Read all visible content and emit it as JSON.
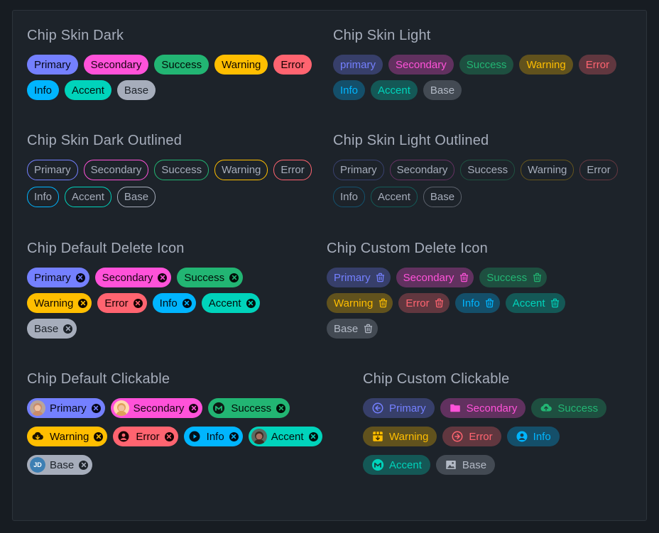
{
  "sections": {
    "dark": {
      "title": "Chip Skin Dark",
      "chips": [
        "Primary",
        "Secondary",
        "Success",
        "Warning",
        "Error",
        "Info",
        "Accent",
        "Base"
      ]
    },
    "light": {
      "title": "Chip Skin Light",
      "chips": [
        "primary",
        "Secondary",
        "Success",
        "Warning",
        "Error",
        "Info",
        "Accent",
        "Base"
      ]
    },
    "dark_outlined": {
      "title": "Chip Skin Dark Outlined",
      "chips": [
        "Primary",
        "Secondary",
        "Success",
        "Warning",
        "Error",
        "Info",
        "Accent",
        "Base"
      ]
    },
    "light_outlined": {
      "title": "Chip Skin Light Outlined",
      "chips": [
        "Primary",
        "Secondary",
        "Success",
        "Warning",
        "Error",
        "Info",
        "Accent",
        "Base"
      ]
    },
    "default_delete": {
      "title": "Chip Default Delete Icon",
      "chips": [
        "Primary",
        "Secondary",
        "Success",
        "Warning",
        "Error",
        "Info",
        "Accent",
        "Base"
      ]
    },
    "custom_delete": {
      "title": "Chip Custom Delete Icon",
      "chips": [
        "Primary",
        "Secondary",
        "Success",
        "Warning",
        "Error",
        "Info",
        "Accent",
        "Base"
      ]
    },
    "default_clickable": {
      "title": "Chip Default Clickable",
      "chips": [
        "Primary",
        "Secondary",
        "Success",
        "Warning",
        "Error",
        "Info",
        "Accent",
        "Base"
      ],
      "base_avatar_initials": "JD"
    },
    "custom_clickable": {
      "title": "Chip Custom Clickable",
      "chips": [
        "Primary",
        "Secondary",
        "Success",
        "Warning",
        "Error",
        "Info",
        "Accent",
        "Base"
      ]
    }
  },
  "icons": {
    "default_clickable": [
      "avatar-photo",
      "avatar-photo",
      "brand-m-icon",
      "cloud-download-icon",
      "user-circle-icon",
      "play-circle-icon",
      "avatar-photo",
      "initials-avatar"
    ],
    "custom_clickable": [
      "arrow-left-circle-icon",
      "folder-icon",
      "cloud-upload-icon",
      "gift-box-icon",
      "arrow-right-circle-icon",
      "user-circle-icon",
      "brand-m-icon",
      "image-icon"
    ]
  },
  "colors": {
    "primary": "#7480ff",
    "secondary": "#ff52d9",
    "success": "#22b573",
    "warning": "#ffbe00",
    "error": "#ff6470",
    "info": "#00b5ff",
    "accent": "#00d3bb",
    "base": "#a6adbb",
    "background": "#1d232a"
  }
}
